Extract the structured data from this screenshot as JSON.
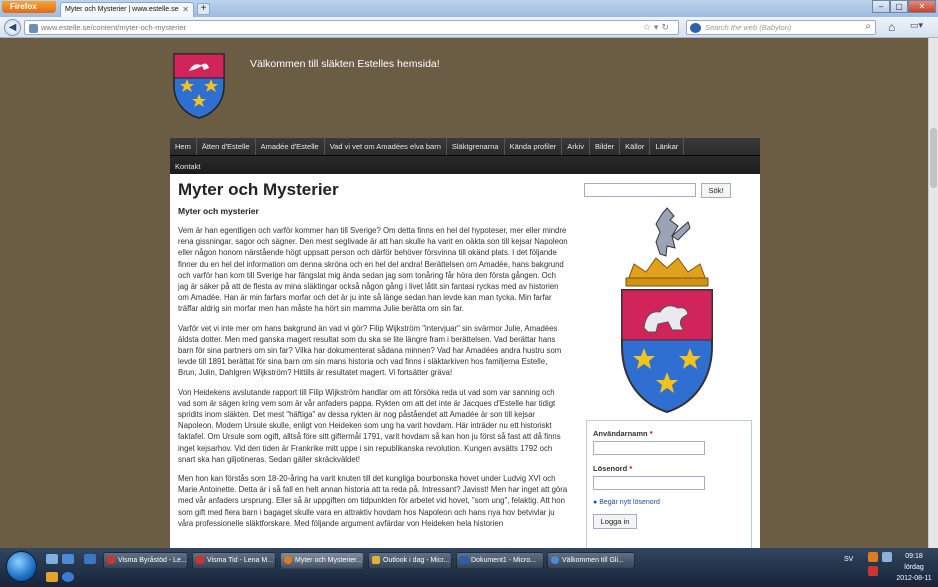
{
  "browser": {
    "app_button": "Firefox",
    "tab_title": "Myter och Mysterier | www.estelle.se",
    "new_tab": "+",
    "url": "www.estelle.se/content/myter-och-mysterier",
    "search_placeholder": "Search the web (Babylon)"
  },
  "site": {
    "title": "Välkommen till släkten Estelles hemsida!",
    "menu_row1": [
      "Hem",
      "Ätten d'Estelle",
      "Amadée d'Estelle",
      "Vad vi vet om Amadées elva barn",
      "Släktgrenarna",
      "Kända profiler",
      "Arkiv",
      "Bilder",
      "Källor",
      "Länkar"
    ],
    "menu_row2": [
      "Kontakt"
    ]
  },
  "article": {
    "heading": "Myter och Mysterier",
    "subheading": "Myter och mysterier",
    "paragraphs": [
      "Vem är han egentligen och varför kommer han till Sverige? Om detta finns en hel del hypoteser, mer eller mindre rena gissningar, sagor och sägner. Den mest seglivade är att han skulle ha varit en oäkta son till kejsar Napoleon eller någon honom närstående högt uppsatt person och därför behöver försvinna till okänd plats. I det följande finner du en hel del information om denna skröna och en hel del andra! Berättelsen om Amadée, hans bakgrund och varför han kom till Sverige har fängslat mig ända sedan jag som tonåring får höra den första gången. Och jag är säker på att de flesta av mina släktingar också någon gång i livet låtit sin fantasi ryckas med av historien om Amadée. Han är min farfars morfar och det är ju inte så länge sedan han levde kan man tycka. Min farfar träffar aldrig sin morfar men han måste ha hört sin mamma Julie berätta om sin far.",
      "Varför vet vi inte mer om hans bakgrund än vad vi gör? Filip Wijkström \"intervjuar\" sin svärmor Julie, Amadées äldsta dotter. Men med ganska magert resultat som du ska se lite längre fram i berättelsen. Vad berättar hans barn för sina partners om sin far? Vilka har dokumenterat sådana minnen? Vad har Amadées andra hustru som levde till 1891 berättat för sina barn om sin mans historia och vad finns i släktarkiven hos familjerna Estelle, Brun, Julin, Dahlgren Wijkström? Hittills är resultatet magert. Vi fortsätter gräva!",
      "Von Heidekens avslutande rapport till Filip Wijkström handlar om att försöka reda ut vad som var sanning och vad som är sägen kring vem som är vår anfaders pappa. Rykten om att det inte är Jacques d'Estelle har tidigt spridits inom släkten. Det mest \"häftiga\" av dessa rykten är nog påståendet att Amadée är son till kejsar Napoleon. Modern Ursule skulle, enligt von Heideken som ung ha varit hovdam. Här inträder nu ett historiskt faktafel. Om Ursule som ogift, alltså före sitt giftermål 1791, varit hovdam så kan hon ju först så fast att då finns inget kejsarhov. Vid den tiden är Frankrike mitt uppe i sin republikanska revolution. Kungen avsätts 1792 och snart ska han giljotineras. Sedan gäller skräckväldet!",
      "Men hon kan förstås som 18-20-åring ha varit knuten till det kungliga bourbonska hovet under Ludvig XVI och Marie Antoinette. Detta är i så fall en helt annan historia att ta reda på. Intressant? Javisst! Men har inget att göra med vår anfaders ursprung. Eller så är uppgiften om tidpunkten för arbetet vid hovet, \"som ung\", felaktig. Att hon som gift med flera barn i bagaget skulle vara en attraktiv hovdam hos Napoleon och hans nya hov betvivlar ju våra professionelle släktforskare. Med följande argument avfärdar von Heideken hela historien"
    ]
  },
  "sidebar": {
    "search_button": "Sök!",
    "username_label": "Användarnamn",
    "password_label": "Lösenord",
    "required_mark": "*",
    "forgot_link": "Begär nytt lösenord",
    "login_button": "Logga in"
  },
  "taskbar": {
    "items": [
      {
        "label": "Visma Byråstöd - Le..."
      },
      {
        "label": "Visma Tid - Lena M..."
      },
      {
        "label": "Myter och Mysterier..."
      },
      {
        "label": "Outlook i dag - Micr..."
      },
      {
        "label": "Dokument1 - Micro..."
      },
      {
        "label": "Välkommen till Gli..."
      }
    ],
    "language": "SV",
    "time": "09:18",
    "day": "lördag",
    "date": "2012-08-11"
  },
  "colors": {
    "page_bg": "#6b5c44",
    "menu_bg": "#2a2a2a",
    "crest_red": "#d0245a",
    "crest_blue": "#2f6fd1",
    "star_gold": "#f2c21d"
  }
}
